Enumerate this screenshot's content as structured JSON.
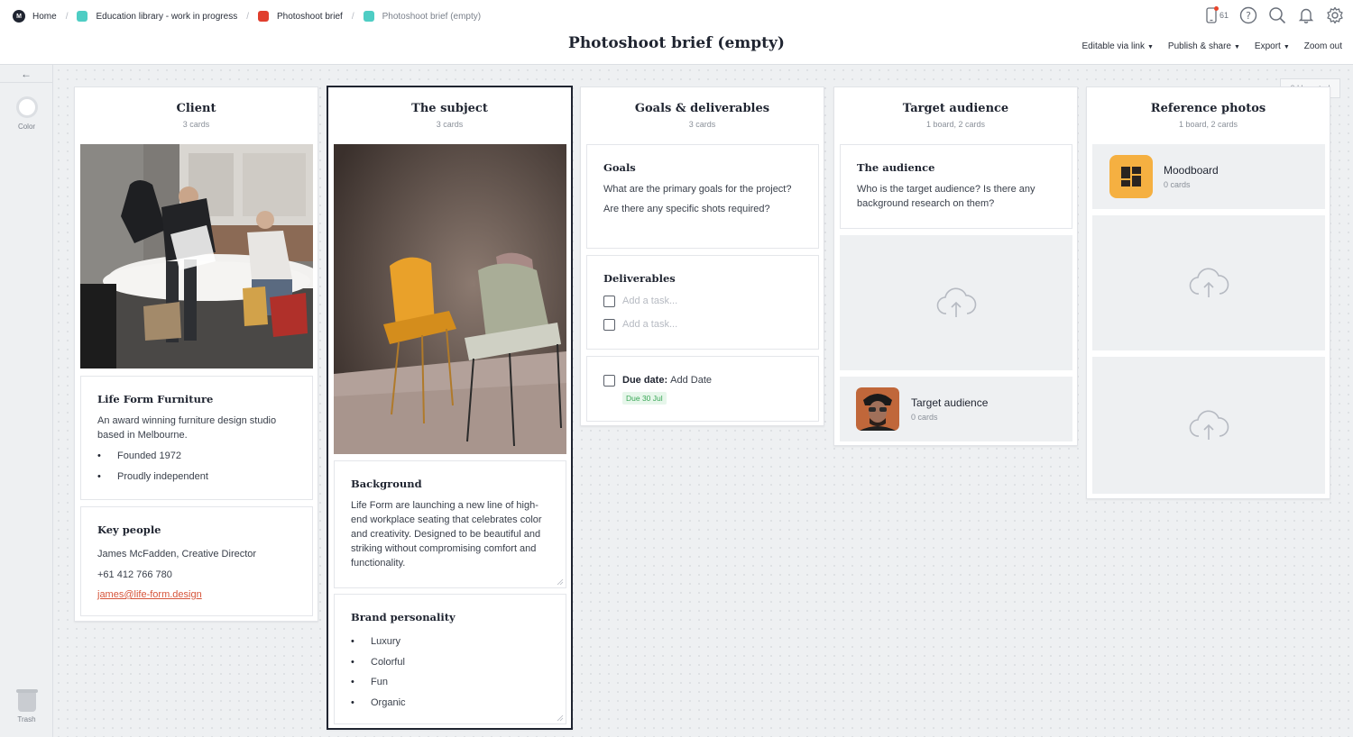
{
  "breadcrumbs": [
    {
      "label": "Home",
      "color": ""
    },
    {
      "label": "Education library - work in progress",
      "color": "#4ecdc4"
    },
    {
      "label": "Photoshoot brief",
      "color": "#e03e2d"
    },
    {
      "label": "Photoshoot brief (empty)",
      "color": "#4ecdc4"
    }
  ],
  "header": {
    "title": "Photoshoot brief (empty)",
    "notification_count": "61",
    "menu": [
      "Editable via link",
      "Publish & share",
      "Export",
      "Zoom out"
    ]
  },
  "sidebar": {
    "back_icon": "arrow-left-icon",
    "color_label": "Color",
    "trash_label": "Trash"
  },
  "unsorted_label": "0 Unsorted",
  "columns": {
    "client": {
      "title": "Client",
      "subtitle": "3 cards",
      "company": {
        "title": "Life Form Furniture",
        "text": "An award winning furniture design studio based in Melbourne.",
        "bullets": [
          "Founded 1972",
          "Proudly independent"
        ]
      },
      "people": {
        "title": "Key people",
        "name": "James McFadden, Creative Director",
        "phone": "+61 412 766 780",
        "email": "james@life-form.design"
      }
    },
    "subject": {
      "title": "The subject",
      "subtitle": "3 cards",
      "background": {
        "title": "Background",
        "text": "Life Form are launching a new line of high-end workplace seating that celebrates color and creativity. Designed to be beautiful and striking without compromising comfort and functionality."
      },
      "personality": {
        "title": "Brand personality",
        "bullets": [
          "Luxury",
          "Colorful",
          "Fun",
          "Organic"
        ]
      }
    },
    "goals": {
      "title": "Goals & deliverables",
      "subtitle": "3 cards",
      "goals_card": {
        "title": "Goals",
        "line1": "What are the primary goals for the project?",
        "line2": "Are there any specific shots required?"
      },
      "deliverables": {
        "title": "Deliverables",
        "tasks": [
          "Add a task...",
          "Add a task..."
        ]
      },
      "due": {
        "label": "Due date:",
        "value": "Add Date",
        "badge": "Due 30 Jul"
      }
    },
    "audience": {
      "title": "Target audience",
      "subtitle": "1 board, 2 cards",
      "audience_card": {
        "title": "The audience",
        "text": "Who is the target audience? Is there any background research on them?"
      },
      "board": {
        "name": "Target audience",
        "count": "0 cards"
      }
    },
    "reference": {
      "title": "Reference photos",
      "subtitle": "1 board, 2 cards",
      "board": {
        "name": "Moodboard",
        "count": "0 cards",
        "color": "#f5b041"
      }
    }
  },
  "colors": {
    "accent_link": "#d6543a",
    "due_green": "#3aa757"
  }
}
